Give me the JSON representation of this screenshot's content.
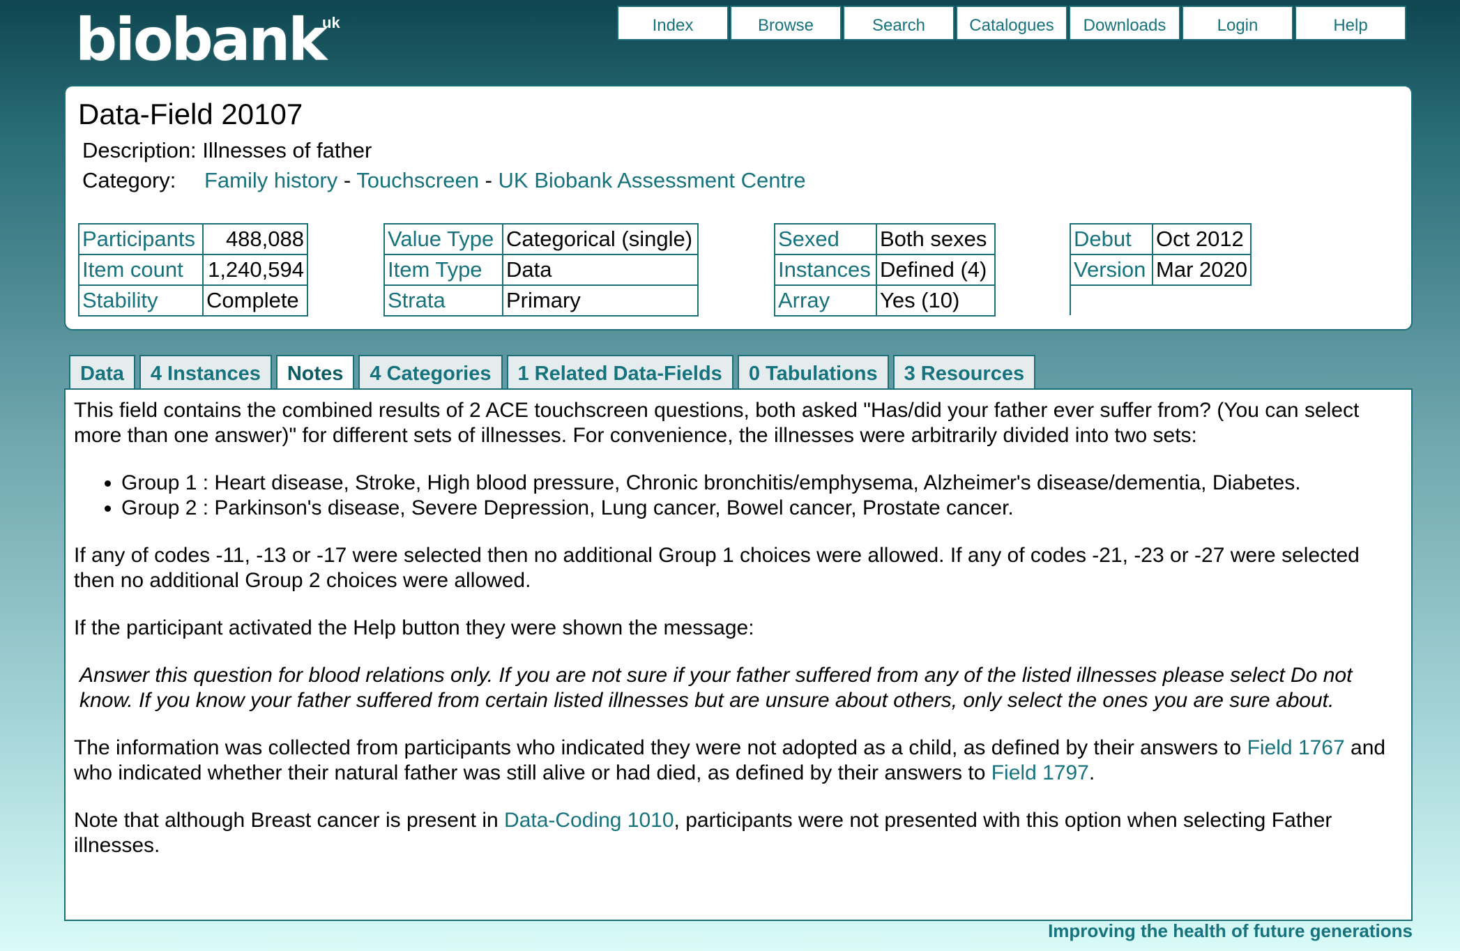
{
  "logo": {
    "text": "biobank",
    "suffix": "uk"
  },
  "nav": [
    "Index",
    "Browse",
    "Search",
    "Catalogues",
    "Downloads",
    "Login",
    "Help"
  ],
  "header": {
    "title": "Data-Field 20107",
    "description_label": "Description:",
    "description": "Illnesses of father",
    "category_label": "Category:",
    "category_links": [
      "Family history",
      "Touchscreen",
      "UK Biobank Assessment Centre"
    ],
    "category_separator": " - "
  },
  "tables": {
    "t1": {
      "participants_label": "Participants",
      "participants": "488,088",
      "item_count_label": "Item count",
      "item_count": "1,240,594",
      "stability_label": "Stability",
      "stability": "Complete"
    },
    "t2": {
      "value_type_label": "Value Type",
      "value_type": "Categorical (single)",
      "item_type_label": "Item Type",
      "item_type": "Data",
      "strata_label": "Strata",
      "strata": "Primary"
    },
    "t3": {
      "sexed_label": "Sexed",
      "sexed": "Both sexes",
      "instances_label": "Instances",
      "instances": "Defined (4)",
      "array_label": "Array",
      "array": "Yes (10)"
    },
    "t4": {
      "debut_label": "Debut",
      "debut": "Oct 2012",
      "version_label": "Version",
      "version": "Mar 2020"
    }
  },
  "tabs": [
    "Data",
    "4 Instances",
    "Notes",
    "4 Categories",
    "1 Related Data-Fields",
    "0 Tabulations",
    "3 Resources"
  ],
  "notes": {
    "p1": "This field contains the combined results of 2 ACE touchscreen questions, both asked \"Has/did your father ever suffer from? (You can select more than one answer)\" for different sets of illnesses. For convenience, the illnesses were arbitrarily divided into two sets:",
    "groups": [
      "Group 1 : Heart disease, Stroke, High blood pressure, Chronic bronchitis/emphysema, Alzheimer's disease/dementia, Diabetes.",
      "Group 2 : Parkinson's disease, Severe Depression, Lung cancer, Bowel cancer, Prostate cancer."
    ],
    "p2": "If any of codes -11, -13 or -17 were selected then no additional Group 1 choices were allowed. If any of codes -21, -23 or -27 were selected then no additional Group 2 choices were allowed.",
    "p3": "If the participant activated the Help button they were shown the message:",
    "quote": "Answer this question for blood relations only. If you are not sure if your father suffered from any of the listed illnesses please select Do not know. If you know your father suffered from certain listed illnesses but are unsure about others, only select the ones you are sure about.",
    "p4_a": "The information was collected from participants who indicated they were not adopted as a child, as defined by their answers to ",
    "p4_link1": "Field 1767",
    "p4_b": " and who indicated whether their natural father was still alive or had died, as defined by their answers to ",
    "p4_link2": "Field 1797",
    "p4_c": ".",
    "p5_a": "Note that although Breast cancer is present in ",
    "p5_link": "Data-Coding 1010",
    "p5_b": ", participants were not presented with this option when selecting Father illnesses."
  },
  "footer": "Improving the health of future generations"
}
